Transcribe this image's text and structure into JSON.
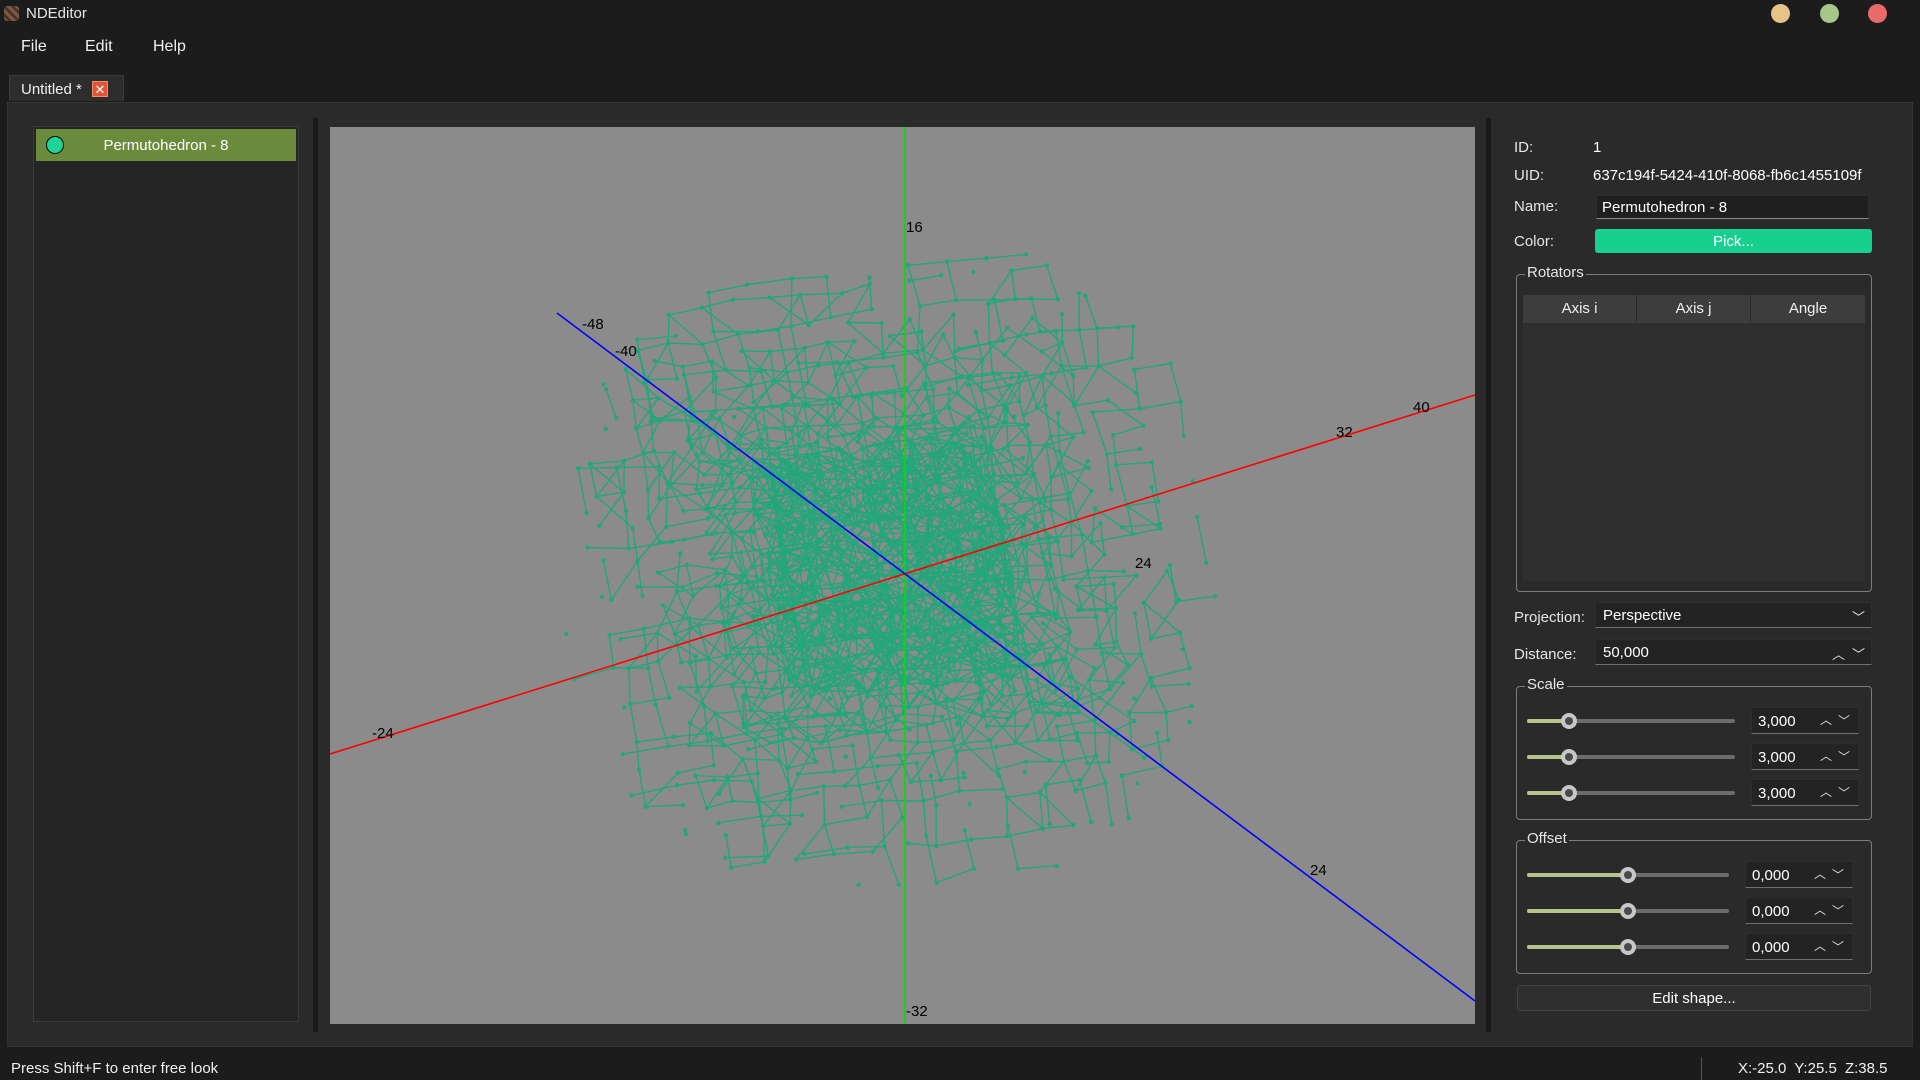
{
  "window": {
    "title": "NDEditor",
    "controls": [
      {
        "name": "minimize",
        "color": "#e7c385"
      },
      {
        "name": "maximize",
        "color": "#a7c78a"
      },
      {
        "name": "close",
        "color": "#ea6a6a"
      }
    ]
  },
  "menu": {
    "file": "File",
    "edit": "Edit",
    "help": "Help"
  },
  "tab": {
    "label": "Untitled *",
    "close_glyph": "✕"
  },
  "shapes": [
    {
      "label": "Permutohedron - 8",
      "color": "#1dd39a"
    }
  ],
  "viewport": {
    "background": "#8b8b8b",
    "wireframe_color": "#23a77a",
    "axes": {
      "x": "#ff0000",
      "y": "#00e000",
      "z": "#0000ff"
    },
    "tick_labels": {
      "x_neg": "-24",
      "x_pos1": "32",
      "x_pos2": "40",
      "x_mid": "24",
      "y_top": "16",
      "y_bottom": "-32",
      "z_neg1": "-48",
      "z_neg2": "-40",
      "z_pos": "24"
    }
  },
  "properties": {
    "id_label": "ID:",
    "id_value": "1",
    "uid_label": "UID:",
    "uid_value": "637c194f-5424-410f-8068-fb6c1455109f",
    "name_label": "Name:",
    "name_value": "Permutohedron - 8",
    "color_label": "Color:",
    "pick_label": "Pick...",
    "pick_color": "#17cf8f",
    "rotators_title": "Rotators",
    "rotator_columns": [
      "Axis i",
      "Axis j",
      "Angle"
    ],
    "projection_label": "Projection:",
    "projection_value": "Perspective",
    "distance_label": "Distance:",
    "distance_value": "50,000",
    "scale_title": "Scale",
    "scale": [
      {
        "value": "3,000",
        "level": 0.2
      },
      {
        "value": "3,000",
        "level": 0.2
      },
      {
        "value": "3,000",
        "level": 0.2
      }
    ],
    "offset_title": "Offset",
    "offset": [
      {
        "value": "0,000",
        "level": 0.5
      },
      {
        "value": "0,000",
        "level": 0.5
      },
      {
        "value": "0,000",
        "level": 0.5
      }
    ],
    "edit_shape_label": "Edit shape..."
  },
  "status": {
    "hint": "Press Shift+F to enter free look",
    "coords": "X:-25.0 Y:25.5 Z:38.5"
  }
}
